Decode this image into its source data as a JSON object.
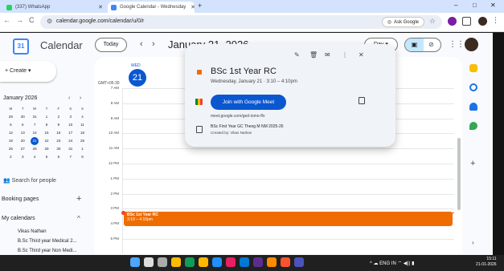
{
  "browser": {
    "tabs": [
      {
        "label": "(337) WhatsApp",
        "color": "#25d366",
        "active": false
      },
      {
        "label": "Google Calendar - Wednesday",
        "color": "#4285f4",
        "active": true
      }
    ],
    "new_tab": "+",
    "window_controls": {
      "minimize": "–",
      "maximize": "□",
      "close": "✕"
    },
    "nav": {
      "back": "←",
      "forward": "→",
      "reload": "C"
    },
    "url": "calendar.google.com/calendar/u/0/r",
    "ask_google": "Ask Google"
  },
  "header": {
    "logo_text": "31",
    "app_title": "Calendar",
    "today_button": "Today",
    "prev": "‹",
    "next": "›",
    "date_title": "January 21, 2026",
    "view_button": "Day ▾"
  },
  "sidebar": {
    "create_button": "+ Create ▾",
    "mini_calendar": {
      "month_label": "January 2026",
      "weekdays": [
        "M",
        "T",
        "W",
        "T",
        "F",
        "S",
        "S"
      ],
      "days": [
        "29",
        "30",
        "31",
        "1",
        "2",
        "3",
        "4",
        "5",
        "6",
        "7",
        "8",
        "9",
        "10",
        "11",
        "12",
        "13",
        "14",
        "15",
        "16",
        "17",
        "18",
        "19",
        "20",
        "21",
        "22",
        "23",
        "24",
        "25",
        "26",
        "27",
        "28",
        "29",
        "30",
        "31",
        "1",
        "2",
        "3",
        "4",
        "5",
        "6",
        "7",
        "8"
      ],
      "today_index": 23
    },
    "search_people": "Search for people",
    "booking_pages": "Booking pages",
    "booking_add": "+",
    "my_calendars": "My calendars",
    "my_calendars_chevron": "^",
    "calendars": [
      "Vikas Nathan",
      "B.Sc Third year Medical 2...",
      "B.Sc Third year Non Medi..."
    ]
  },
  "day_view": {
    "day_name": "WED",
    "day_number": "21",
    "timezone": "GMT+05:30",
    "hours": [
      "7 AM",
      "8 AM",
      "9 AM",
      "10 AM",
      "11 AM",
      "12 PM",
      "1 PM",
      "2 PM",
      "3 PM",
      "4 PM",
      "5 PM"
    ],
    "event": {
      "title": "BSc 1st Year RC",
      "time": "3:10 – 4:10pm",
      "color": "#ef6c00"
    }
  },
  "popup": {
    "actions": {
      "edit": "✎",
      "delete": "🗑",
      "email": "✉",
      "more": "⋮",
      "close": "✕"
    },
    "title": "BSc 1st Year RC",
    "when": "Wednesday, January 21  ·  3:10 – 4:10pm",
    "join_button": "Join with Google Meet",
    "meet_link": "meet.google.com/ged-iomo-ffx",
    "description": "BSc First Year GC Theog M NM 2025-26",
    "created_by": "Created by: Vikas Nathan"
  },
  "taskbar": {
    "tray": "^  ☁  ENG IN  ⌔  ◀))  ▮",
    "time": "15:11",
    "date": "21-01-2026",
    "apps": [
      {
        "name": "windows",
        "color": "#4ca6ff"
      },
      {
        "name": "search",
        "color": "#dddddd"
      },
      {
        "name": "task-view",
        "color": "#aaaaaa"
      },
      {
        "name": "chrome",
        "color": "#fbbc04"
      },
      {
        "name": "edge",
        "color": "#0f9d58"
      },
      {
        "name": "file-explorer",
        "color": "#ffb900"
      },
      {
        "name": "edge-browser",
        "color": "#1e90ff"
      },
      {
        "name": "photos",
        "color": "#e91e63"
      },
      {
        "name": "outlook",
        "color": "#0078d4"
      },
      {
        "name": "store",
        "color": "#5c2d91"
      },
      {
        "name": "office",
        "color": "#ff8c00"
      },
      {
        "name": "brave",
        "color": "#fb542b"
      },
      {
        "name": "teams",
        "color": "#4b53bc"
      }
    ]
  }
}
